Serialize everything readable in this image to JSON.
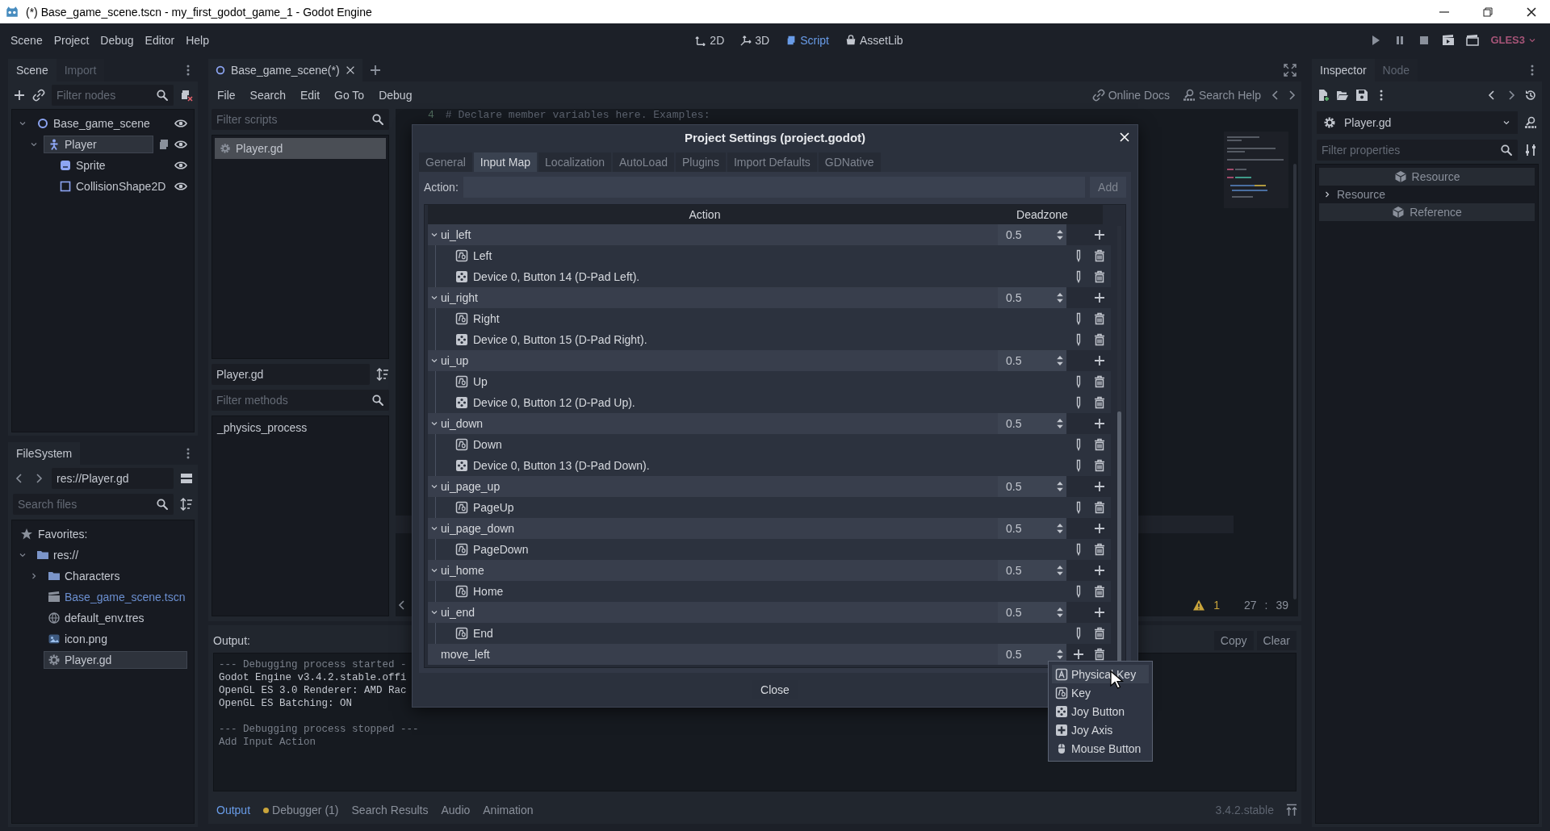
{
  "window": {
    "title": "(*) Base_game_scene.tscn - my_first_godot_game_1 - Godot Engine"
  },
  "menu": [
    "Scene",
    "Project",
    "Debug",
    "Editor",
    "Help"
  ],
  "workspaces": [
    {
      "label": "2D",
      "kind": "planar",
      "selected": false
    },
    {
      "label": "3D",
      "kind": "spatial",
      "selected": false
    },
    {
      "label": "Script",
      "kind": "script",
      "selected": true
    },
    {
      "label": "AssetLib",
      "kind": "assetlib",
      "selected": false
    }
  ],
  "renderer": "GLES3",
  "scene_dock": {
    "tabs": [
      {
        "label": "Scene",
        "selected": true
      },
      {
        "label": "Import",
        "selected": false
      }
    ],
    "filter": {
      "placeholder": "Filter nodes"
    },
    "tree": [
      {
        "name": "Base_game_scene",
        "kind": "node2d",
        "selected": false,
        "visible": true,
        "script": false,
        "expanded": true,
        "children": [
          {
            "name": "Player",
            "kind": "body",
            "selected": true,
            "visible": true,
            "script": true,
            "expanded": true,
            "children": [
              {
                "name": "Sprite",
                "kind": "sprite",
                "selected": false,
                "visible": true,
                "script": false
              },
              {
                "name": "CollisionShape2D",
                "kind": "shape",
                "selected": false,
                "visible": true,
                "script": false
              }
            ]
          }
        ]
      }
    ]
  },
  "filesystem_dock": {
    "tabs": [
      {
        "label": "FileSystem",
        "selected": true
      }
    ],
    "path": "res://Player.gd",
    "search": {
      "placeholder": "Search files"
    },
    "favorites": "Favorites:",
    "tree": [
      {
        "name": "res://",
        "kind": "folder",
        "expanded": true,
        "selected": false,
        "highlighted": false,
        "children": [
          {
            "name": "Characters",
            "kind": "folder",
            "expanded": false,
            "selected": false,
            "highlighted": false
          },
          {
            "name": "Base_game_scene.tscn",
            "kind": "scene",
            "selected": false,
            "highlighted": true
          },
          {
            "name": "default_env.tres",
            "kind": "environment",
            "selected": false,
            "highlighted": false
          },
          {
            "name": "icon.png",
            "kind": "image",
            "selected": false,
            "highlighted": false
          },
          {
            "name": "Player.gd",
            "kind": "script",
            "selected": true,
            "highlighted": false
          }
        ]
      }
    ]
  },
  "script_editor": {
    "tabs": [
      {
        "label": "Base_game_scene(*)",
        "selected": true
      }
    ],
    "menu": [
      "File",
      "Search",
      "Edit",
      "Go To",
      "Debug"
    ],
    "help_links": [
      {
        "label": "Online Docs",
        "kind": "docs"
      },
      {
        "label": "Search Help",
        "kind": "search"
      }
    ],
    "scripts_filter": {
      "placeholder": "Filter scripts"
    },
    "scripts": [
      {
        "name": "Player.gd",
        "selected": true
      }
    ],
    "current_script": "Player.gd",
    "methods_filter": {
      "placeholder": "Filter methods"
    },
    "methods": [
      "_physics_process"
    ],
    "code_lines": [
      {
        "number": "4",
        "text": "# Declare member variables here. Examples:"
      }
    ],
    "warnings": "1",
    "cursor": {
      "line": "27",
      "separator": ":",
      "column": "39"
    }
  },
  "output": {
    "label": "Output:",
    "buttons": [
      "Copy",
      "Clear"
    ],
    "blocks": [
      [
        {
          "text": "--- Debugging process started -",
          "dim": true
        },
        {
          "text": "Godot Engine v3.4.2.stable.offi",
          "dim": false
        },
        {
          "text": "OpenGL ES 3.0 Renderer: AMD Rac",
          "dim": false
        },
        {
          "text": "OpenGL ES Batching: ON",
          "dim": false
        }
      ],
      [
        {
          "text": "--- Debugging process stopped ---",
          "dim": true
        },
        {
          "text": "Add Input Action",
          "dim": true
        }
      ]
    ],
    "version": "3.4.2.stable"
  },
  "bottom_tabs": [
    {
      "label": "Output",
      "selected": true,
      "alert": false
    },
    {
      "label": "Debugger (1)",
      "selected": false,
      "alert": true
    },
    {
      "label": "Search Results",
      "selected": false,
      "alert": false
    },
    {
      "label": "Audio",
      "selected": false,
      "alert": false
    },
    {
      "label": "Animation",
      "selected": false,
      "alert": false
    }
  ],
  "inspector": {
    "tabs": [
      {
        "label": "Inspector",
        "selected": true
      },
      {
        "label": "Node",
        "selected": false
      }
    ],
    "resource": "Player.gd",
    "filter": {
      "placeholder": "Filter properties"
    },
    "sections": [
      {
        "kind": "category",
        "label": "Resource"
      },
      {
        "kind": "group",
        "label": "Resource",
        "expanded": false
      },
      {
        "kind": "category",
        "label": "Reference"
      }
    ]
  },
  "dialog": {
    "title": "Project Settings (project.godot)",
    "tabs": [
      {
        "label": "General",
        "selected": false
      },
      {
        "label": "Input Map",
        "selected": true
      },
      {
        "label": "Localization",
        "selected": false
      },
      {
        "label": "AutoLoad",
        "selected": false
      },
      {
        "label": "Plugins",
        "selected": false
      },
      {
        "label": "Import Defaults",
        "selected": false
      },
      {
        "label": "GDNative",
        "selected": false
      }
    ],
    "action_label": "Action:",
    "add_button": "Add",
    "columns": [
      "Action",
      "Deadzone"
    ],
    "actions": [
      {
        "name": "ui_left",
        "deadzone": "0.5",
        "expanded": true,
        "removable": false,
        "events": [
          {
            "kind": "key",
            "label": "Left"
          },
          {
            "kind": "joy_button",
            "label": "Device 0, Button 14 (D-Pad Left)."
          }
        ]
      },
      {
        "name": "ui_right",
        "deadzone": "0.5",
        "expanded": true,
        "removable": false,
        "events": [
          {
            "kind": "key",
            "label": "Right"
          },
          {
            "kind": "joy_button",
            "label": "Device 0, Button 15 (D-Pad Right)."
          }
        ]
      },
      {
        "name": "ui_up",
        "deadzone": "0.5",
        "expanded": true,
        "removable": false,
        "events": [
          {
            "kind": "key",
            "label": "Up"
          },
          {
            "kind": "joy_button",
            "label": "Device 0, Button 12 (D-Pad Up)."
          }
        ]
      },
      {
        "name": "ui_down",
        "deadzone": "0.5",
        "expanded": true,
        "removable": false,
        "events": [
          {
            "kind": "key",
            "label": "Down"
          },
          {
            "kind": "joy_button",
            "label": "Device 0, Button 13 (D-Pad Down)."
          }
        ]
      },
      {
        "name": "ui_page_up",
        "deadzone": "0.5",
        "expanded": true,
        "removable": false,
        "events": [
          {
            "kind": "key",
            "label": "PageUp"
          }
        ]
      },
      {
        "name": "ui_page_down",
        "deadzone": "0.5",
        "expanded": true,
        "removable": false,
        "events": [
          {
            "kind": "key",
            "label": "PageDown"
          }
        ]
      },
      {
        "name": "ui_home",
        "deadzone": "0.5",
        "expanded": true,
        "removable": false,
        "events": [
          {
            "kind": "key",
            "label": "Home"
          }
        ]
      },
      {
        "name": "ui_end",
        "deadzone": "0.5",
        "expanded": true,
        "removable": false,
        "events": [
          {
            "kind": "key",
            "label": "End"
          }
        ]
      },
      {
        "name": "move_left",
        "deadzone": "0.5",
        "removable": true
      }
    ],
    "close_button": "Close"
  },
  "popup_menu": {
    "items": [
      {
        "label": "Physical Key",
        "kind": "physical_key",
        "selected": true
      },
      {
        "label": "Key",
        "kind": "key",
        "selected": false
      },
      {
        "label": "Joy Button",
        "kind": "joy_button",
        "selected": false
      },
      {
        "label": "Joy Axis",
        "kind": "joy_axis",
        "selected": false
      },
      {
        "label": "Mouse Button",
        "kind": "mouse_button",
        "selected": false
      }
    ]
  }
}
